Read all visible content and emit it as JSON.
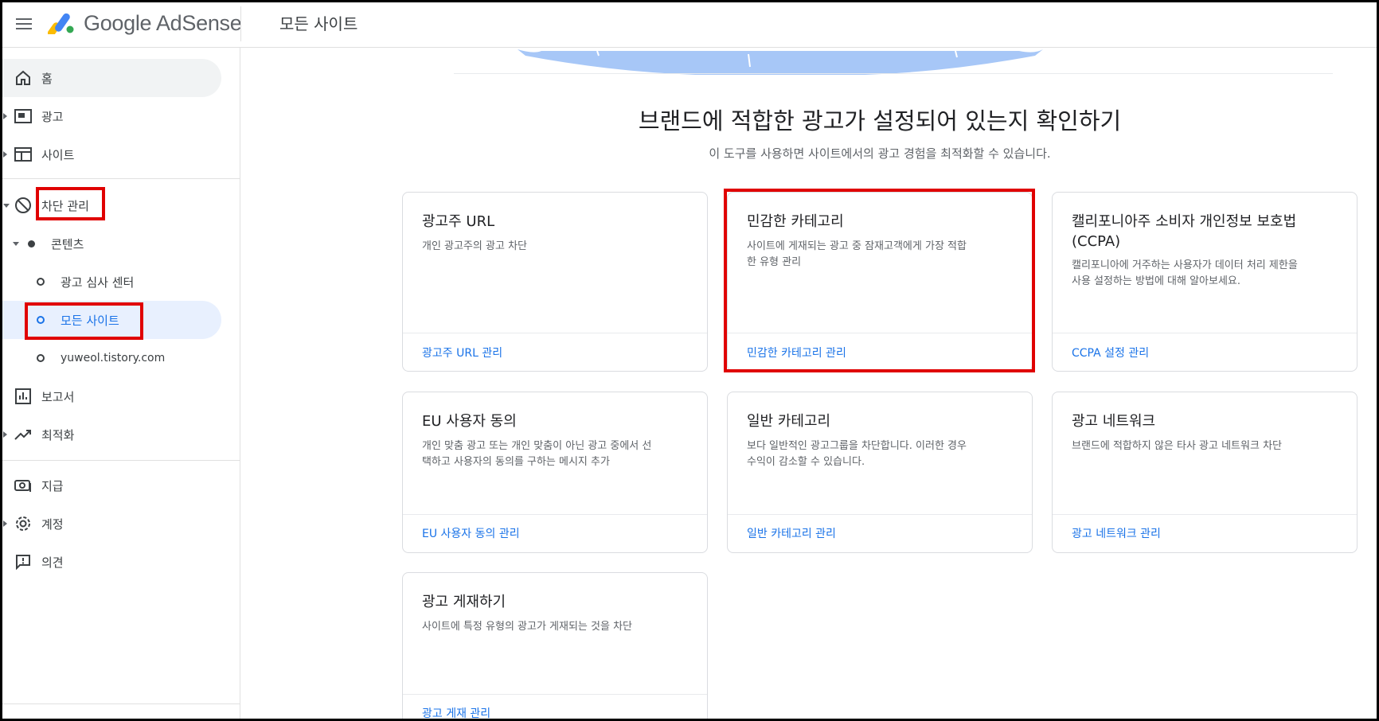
{
  "header": {
    "brand": "Google AdSense",
    "page_title": "모든 사이트"
  },
  "sidebar": {
    "home": "홈",
    "ads": "광고",
    "sites": "사이트",
    "blocking": "차단 관리",
    "content": "콘텐츠",
    "ad_review": "광고 심사 센터",
    "all_sites": "모든 사이트",
    "site_domain": "yuweol.tistory.com",
    "reports": "보고서",
    "optimize": "최적화",
    "payments": "지급",
    "account": "계정",
    "feedback": "의견"
  },
  "main": {
    "title": "브랜드에 적합한 광고가 설정되어 있는지 확인하기",
    "subtitle": "이 도구를 사용하면 사이트에서의 광고 경험을 최적화할 수 있습니다.",
    "cards": [
      {
        "title": "광고주 URL",
        "desc_1": "개인 광고주의 광고 차단",
        "desc_2": "",
        "link": "광고주 URL 관리"
      },
      {
        "title": "민감한 카테고리",
        "desc_1": "사이트에 게재되는 광고 중 잠재고객에게 가장 적합",
        "desc_2": "한 유형 관리",
        "link": "민감한 카테고리 관리"
      },
      {
        "title_1": "캘리포니아주 소비자 개인정보 보호법",
        "title_2": "(CCPA)",
        "desc_1": "캘리포니아에 거주하는 사용자가 데이터 처리 제한을",
        "desc_2": "사용 설정하는 방법에 대해 알아보세요.",
        "link": "CCPA 설정 관리"
      },
      {
        "title": "EU 사용자 동의",
        "desc_1": "개인 맞춤 광고 또는 개인 맞춤이 아닌 광고 중에서 선",
        "desc_2": "택하고 사용자의 동의를 구하는 메시지 추가",
        "link": "EU 사용자 동의 관리"
      },
      {
        "title": "일반 카테고리",
        "desc_1": "보다 일반적인 광고그룹을 차단합니다. 이러한 경우",
        "desc_2": "수익이 감소할 수 있습니다.",
        "link": "일반 카테고리 관리"
      },
      {
        "title": "광고 네트워크",
        "desc_1": "브랜드에 적합하지 않은 타사 광고 네트워크 차단",
        "desc_2": "",
        "link": "광고 네트워크 관리"
      },
      {
        "title": "광고 게재하기",
        "desc_1": "사이트에 특정 유형의 광고가 게재되는 것을 차단",
        "desc_2": "",
        "link": "광고 게재 관리"
      }
    ]
  },
  "colors": {
    "accent": "#1a73e8",
    "highlight_border": "#e00000",
    "active_nav_bg": "#e8f0fe"
  },
  "icons": [
    "menu-icon",
    "adsense-logo",
    "home-icon",
    "ads-icon",
    "sites-icon",
    "block-icon",
    "reports-icon",
    "optimize-icon",
    "payments-icon",
    "account-gear-icon",
    "feedback-icon"
  ]
}
